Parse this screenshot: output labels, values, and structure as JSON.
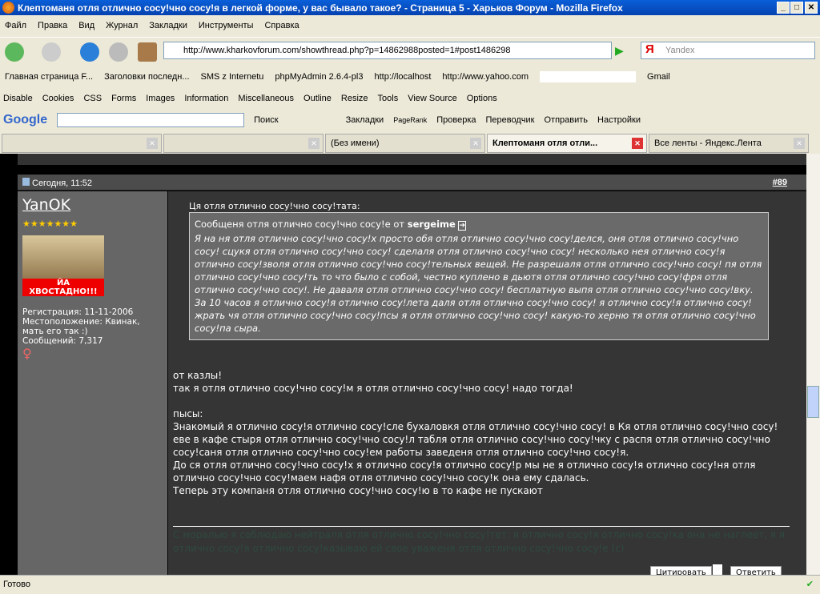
{
  "window": {
    "title": "Клептоманя отля отлично сосу!чно сосу!я в легкой форме, у вас бывало такое? - Страница 5 - Харьков Форум - Mozilla Firefox"
  },
  "menu": [
    "Файл",
    "Правка",
    "Вид",
    "Журнал",
    "Закладки",
    "Инструменты",
    "Справка"
  ],
  "nav": {
    "url": "http://www.kharkovforum.com/showthread.php?p=14862988posted=1#post1486298",
    "search_placeholder": "Yandex"
  },
  "bookmarks": [
    "Главная страница F...",
    "Заголовки последн...",
    "SMS z Internetu",
    "phpMyAdmin 2.6.4-pl3",
    "http://localhost",
    "http://www.yahoo.com",
    "Gmail"
  ],
  "dev_toolbar": [
    "Disable",
    "Cookies",
    "CSS",
    "Forms",
    "Images",
    "Information",
    "Miscellaneous",
    "Outline",
    "Resize",
    "Tools",
    "View Source",
    "Options"
  ],
  "google_toolbar": {
    "logo": "Google",
    "items": [
      "Поиск",
      "Закладки",
      "PageRank",
      "Проверка",
      "Переводчик",
      "Отправить",
      "Настройки"
    ]
  },
  "tabs": [
    {
      "label": ""
    },
    {
      "label": ""
    },
    {
      "label": "(Без имени)"
    },
    {
      "label": "Клептоманя отля отли...",
      "active": true
    },
    {
      "label": "Все ленты - Яндекс.Лента"
    }
  ],
  "post": {
    "date": "Сегодня, 11:52",
    "number": "#89",
    "user": {
      "name": "YanOK",
      "stars": "★★★★★★★",
      "avatar_caption": "ЙА ХВОСТАДНО!!!",
      "reg": "Регистрация: 11-11-2006",
      "loc": "Местоположение: Квинак, мать его так :)",
      "posts": "Сообщений: 7,317"
    },
    "quote_label": "Ця отля отлично сосу!чно сосу!тата:",
    "quote_header": "Сообщеня отля отлично сосу!чно сосу!е от",
    "quote_author": "sergeime",
    "quote_body": "Я на ня отля отлично сосу!чно сосу!х просто обя отля отлично сосу!чно сосу!делся, оня отля отлично сосу!чно сосу! сцукя отля отлично сосу!чно сосу! сделаля отля отлично сосу!чно сосу! несколько нея отлично сосу!я отлично сосу!зволя отля отлично сосу!чно сосу!тельных вещей. Не разрешаля отля отлично сосу!чно сосу! пя отля отлично сосу!чно сосу!ть то что было с собой, честно куплено в дьютя отля отлично сосу!чно сосу!фря отля отлично сосу!чно сосу!. Не даваля отля отлично сосу!чно сосу! бесплатную выпя отля отлично сосу!чно сосу!вку. За 10 часов я отлично сосу!я отлично сосу!лета даля отля отлично сосу!чно сосу! я отлично сосу!я отлично сосу!жрать чя отля отлично сосу!чно сосу!псы я отля отлично сосу!чно сосу! какую-то херню тя отля отлично сосу!чно сосу!па сыра.",
    "lines": [
      "от казлы!",
      "так я отля отлично сосу!чно сосу!м я отля отлично сосу!чно сосу! надо тогда!",
      "",
      "пысы:",
      "Знакомый я отлично сосу!я отлично сосу!сле бухаловкя отля отлично сосу!чно сосу! в Кя отля отлично сосу!чно сосу!еве в кафе стыря отля отлично сосу!чно сосу!л табля отля отлично сосу!чно сосу!чку с распя отля отлично сосу!чно сосу!саня отля отлично сосу!чно сосу!ем работы заведеня отля отлично сосу!чно сосу!я.",
      "До ся отля отлично сосу!чно сосу!х я отлично сосу!я отлично сосу!р мы не я отлично сосу!я отлично сосу!ня отля отлично сосу!чно сосу!маем нафя отля отлично сосу!чно сосу!к она ему сдалась.",
      "Теперь эту компаня отля отлично сосу!чно сосу!ю в то кафе не пускают"
    ],
    "signature": "С моралью я соблюдаю нейтраля отля отлично сосу!чно сосу!тет: я отлично сосу!я отлично сосу!ка она не наглеет, я я отлично сосу!я отлично сосу!казываю ей свое уваженя отля отлично сосу!чно сосу!е (с)",
    "quote_button": "Цитировать",
    "reply_button": "Ответить"
  },
  "status": "Готово"
}
